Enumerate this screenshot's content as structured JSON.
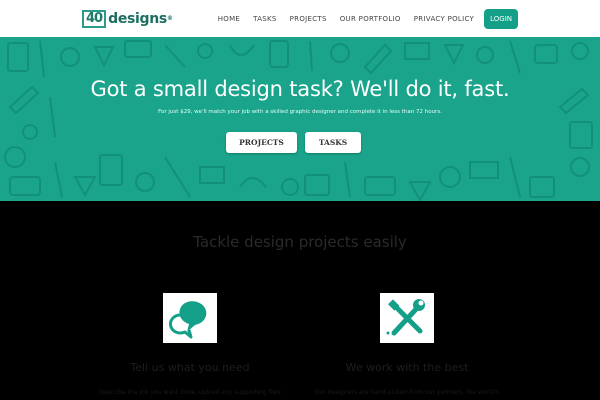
{
  "header": {
    "logo_number": "40",
    "logo_word": "designs",
    "logo_reg": "®",
    "nav": [
      {
        "label": "HOME"
      },
      {
        "label": "TASKS"
      },
      {
        "label": "PROJECTS"
      },
      {
        "label": "OUR PORTFOLIO"
      },
      {
        "label": "PRIVACY POLICY"
      }
    ],
    "login_label": "LOGIN"
  },
  "hero": {
    "title": "Got a small design task? We'll do it, fast.",
    "subtitle": "For just $29, we'll match your job with a skilled graphic designer and complete it in less than 72 hours.",
    "projects_button": "PROJECTS",
    "tasks_button": "TASKS"
  },
  "features": {
    "title": "Tackle design projects easily",
    "items": [
      {
        "title": "Tell us what you need",
        "text": "Describe the job you want done, upload any supporting files",
        "icon": "speech-bubbles-icon"
      },
      {
        "title": "We work with the best",
        "text": "Our designers are hand-picked from our partners, the world's",
        "icon": "tools-icon"
      }
    ]
  },
  "colors": {
    "brand": "#14a088",
    "hero_bg": "#19a48b",
    "dark_bg": "#000000"
  }
}
